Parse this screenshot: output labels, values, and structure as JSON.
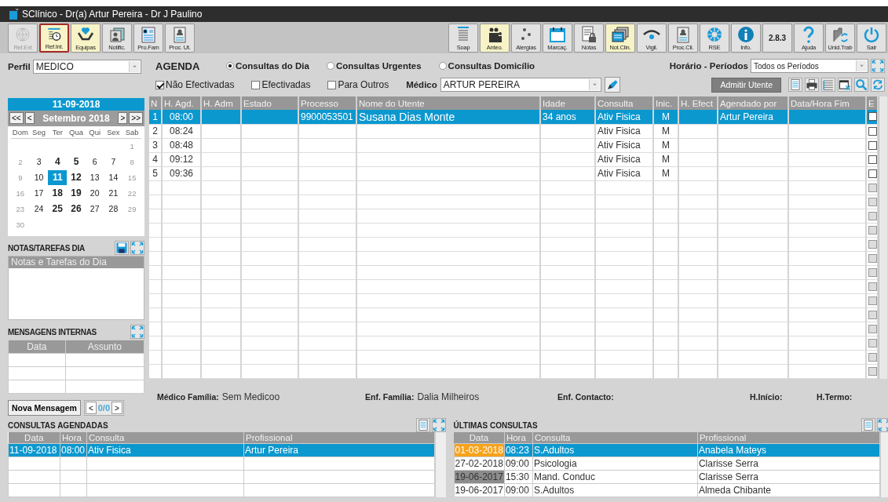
{
  "window": {
    "title": "SClínico - Dr(a) Artur Pereira - Dr J Paulino"
  },
  "toolbar": {
    "left": [
      {
        "label": "Ref.Ext",
        "kind": "network",
        "disabled": true,
        "highlighted": false,
        "selected": false
      },
      {
        "label": "Ref.Int.",
        "kind": "doc-clock",
        "disabled": false,
        "highlighted": true,
        "selected": true
      },
      {
        "label": "Equipas",
        "kind": "heart-hands",
        "disabled": false,
        "highlighted": true,
        "selected": false
      },
      {
        "label": "Notific.",
        "kind": "person-stack",
        "disabled": false,
        "highlighted": false,
        "selected": false
      },
      {
        "label": "Pro.Fam",
        "kind": "family-doc",
        "disabled": false,
        "highlighted": false,
        "selected": false
      },
      {
        "label": "Proc. Ut.",
        "kind": "person-card",
        "disabled": false,
        "highlighted": false,
        "selected": false
      }
    ],
    "right": [
      {
        "label": "Soap",
        "kind": "list",
        "disabled": false,
        "highlighted": false,
        "selected": false
      },
      {
        "label": "Anteo.",
        "kind": "people",
        "disabled": false,
        "highlighted": true,
        "selected": false
      },
      {
        "label": "Alergias",
        "kind": "dots",
        "disabled": false,
        "highlighted": false,
        "selected": false
      },
      {
        "label": "Marcaç.",
        "kind": "calendar",
        "disabled": false,
        "highlighted": false,
        "selected": false
      },
      {
        "label": "Notas",
        "kind": "doc-lock",
        "disabled": false,
        "highlighted": false,
        "selected": false
      },
      {
        "label": "Not.Clin.",
        "kind": "stack",
        "disabled": false,
        "highlighted": true,
        "selected": false
      },
      {
        "label": "Vigil.",
        "kind": "eye",
        "disabled": false,
        "highlighted": false,
        "selected": false
      },
      {
        "label": "Proc.Cli.",
        "kind": "person-card",
        "disabled": false,
        "highlighted": false,
        "selected": false
      },
      {
        "label": "RSE",
        "kind": "gear",
        "disabled": false,
        "highlighted": false,
        "selected": false
      },
      {
        "label": "Info.",
        "kind": "info",
        "disabled": false,
        "highlighted": false,
        "selected": false
      },
      {
        "label": "2.8.3",
        "kind": "version",
        "disabled": false,
        "highlighted": false,
        "selected": false
      },
      {
        "label": "Ajuda",
        "kind": "question",
        "disabled": false,
        "highlighted": false,
        "selected": false
      },
      {
        "label": "Unid.Trab",
        "kind": "building-refresh",
        "disabled": false,
        "highlighted": false,
        "selected": false
      },
      {
        "label": "Sair",
        "kind": "power",
        "disabled": false,
        "highlighted": false,
        "selected": false
      }
    ]
  },
  "sidebar": {
    "profile": {
      "label": "Perfil",
      "value": "MEDICO"
    },
    "calendar": {
      "date": "11-09-2018",
      "month": "Setembro 2018",
      "nav": [
        "<<",
        "<",
        ">",
        ">>"
      ],
      "weekdays": [
        "Dom",
        "Seg",
        "Ter",
        "Qua",
        "Qui",
        "Sex",
        "Sab"
      ],
      "weeks": [
        {
          "kind": "first",
          "days": [
            {
              "day": "1",
              "kind": "weekend",
              "selected": false
            }
          ]
        },
        {
          "kind": "full",
          "days": [
            {
              "day": "2",
              "kind": "weekend",
              "selected": false
            },
            {
              "day": "3",
              "kind": "plain",
              "selected": false
            },
            {
              "day": "4",
              "kind": "marked",
              "selected": false
            },
            {
              "day": "5",
              "kind": "marked",
              "selected": false
            },
            {
              "day": "6",
              "kind": "plain",
              "selected": false
            },
            {
              "day": "7",
              "kind": "plain",
              "selected": false
            },
            {
              "day": "8",
              "kind": "weekend",
              "selected": false
            }
          ]
        },
        {
          "kind": "full",
          "days": [
            {
              "day": "9",
              "kind": "weekend",
              "selected": false
            },
            {
              "day": "10",
              "kind": "plain",
              "selected": false
            },
            {
              "day": "11",
              "kind": "marked",
              "selected": true
            },
            {
              "day": "12",
              "kind": "marked",
              "selected": false
            },
            {
              "day": "13",
              "kind": "plain",
              "selected": false
            },
            {
              "day": "14",
              "kind": "plain",
              "selected": false
            },
            {
              "day": "15",
              "kind": "weekend",
              "selected": false
            }
          ]
        },
        {
          "kind": "full",
          "days": [
            {
              "day": "16",
              "kind": "weekend",
              "selected": false
            },
            {
              "day": "17",
              "kind": "plain",
              "selected": false
            },
            {
              "day": "18",
              "kind": "marked",
              "selected": false
            },
            {
              "day": "19",
              "kind": "marked",
              "selected": false
            },
            {
              "day": "20",
              "kind": "plain",
              "selected": false
            },
            {
              "day": "21",
              "kind": "plain",
              "selected": false
            },
            {
              "day": "22",
              "kind": "weekend",
              "selected": false
            }
          ]
        },
        {
          "kind": "full",
          "days": [
            {
              "day": "23",
              "kind": "weekend",
              "selected": false
            },
            {
              "day": "24",
              "kind": "plain",
              "selected": false
            },
            {
              "day": "25",
              "kind": "marked",
              "selected": false
            },
            {
              "day": "26",
              "kind": "marked",
              "selected": false
            },
            {
              "day": "27",
              "kind": "plain",
              "selected": false
            },
            {
              "day": "28",
              "kind": "plain",
              "selected": false
            },
            {
              "day": "29",
              "kind": "weekend",
              "selected": false
            }
          ]
        },
        {
          "kind": "last",
          "days": [
            {
              "day": "30",
              "kind": "weekend",
              "selected": false
            }
          ]
        }
      ]
    },
    "notes": {
      "title": "NOTAS/TAREFAS DIA",
      "header": "Notas e Tarefas do Dia"
    },
    "messages": {
      "title": "MENSAGENS INTERNAS",
      "columns": [
        "Data",
        "Assunto"
      ],
      "new_button": "Nova Mensagem",
      "prev": "<",
      "count": "0/0",
      "next": ">"
    }
  },
  "agenda": {
    "title": "AGENDA",
    "radios": [
      {
        "label": "Consultas do Dia",
        "selected": true
      },
      {
        "label": "Consultas Urgentes",
        "selected": false
      },
      {
        "label": "Consultas Domicílio",
        "selected": false
      }
    ],
    "filters": [
      {
        "label": "Não Efectivadas",
        "checked": true
      },
      {
        "label": "Efectivadas",
        "checked": false
      },
      {
        "label": "Para Outros",
        "checked": false
      }
    ],
    "doctor": {
      "label": "Médico",
      "value": "ARTUR PEREIRA"
    },
    "periods": {
      "label": "Horário - Períodos",
      "value": "Todos os Períodos"
    },
    "admit_button": "Admitir Utente",
    "table": {
      "columns": [
        "N",
        "H. Agd.",
        "H. Adm",
        "Estado",
        "Processo",
        "Nome do Utente",
        "Idade",
        "Consulta",
        "Inic.",
        "H. Efect",
        "Agendado por",
        "Data/Hora Fim",
        "E"
      ],
      "rows": [
        {
          "n": "1",
          "h_agd": "08:00",
          "processo": "9900053501",
          "nome": "Susana Dias Monte",
          "idade": "34 anos",
          "consulta": "Ativ Fisica",
          "inic": "M",
          "agendado_por": "Artur Pereira",
          "selected": true,
          "checked": false,
          "disabled": false
        },
        {
          "n": "2",
          "h_agd": "08:24",
          "consulta": "Ativ Fisica",
          "inic": "M",
          "selected": false,
          "checked": false,
          "disabled": false
        },
        {
          "n": "3",
          "h_agd": "08:48",
          "consulta": "Ativ Fisica",
          "inic": "M",
          "selected": false,
          "checked": false,
          "disabled": false
        },
        {
          "n": "4",
          "h_agd": "09:12",
          "consulta": "Ativ Fisica",
          "inic": "M",
          "selected": false,
          "checked": false,
          "disabled": false
        },
        {
          "n": "5",
          "h_agd": "09:36",
          "consulta": "Ativ Fisica",
          "inic": "M",
          "selected": false,
          "checked": false,
          "disabled": false
        },
        {
          "selected": false,
          "checked": false,
          "disabled": true
        },
        {
          "selected": false,
          "checked": false,
          "disabled": true
        },
        {
          "selected": false,
          "checked": false,
          "disabled": true
        },
        {
          "selected": false,
          "checked": false,
          "disabled": true
        },
        {
          "selected": false,
          "checked": false,
          "disabled": true
        },
        {
          "selected": false,
          "checked": false,
          "disabled": true
        },
        {
          "selected": false,
          "checked": false,
          "disabled": true
        },
        {
          "selected": false,
          "checked": false,
          "disabled": true
        },
        {
          "selected": false,
          "checked": false,
          "disabled": true
        },
        {
          "selected": false,
          "checked": false,
          "disabled": true
        },
        {
          "selected": false,
          "checked": false,
          "disabled": true
        },
        {
          "selected": false,
          "checked": false,
          "disabled": true
        },
        {
          "selected": false,
          "checked": false,
          "disabled": true
        },
        {
          "selected": false,
          "checked": false,
          "disabled": true
        }
      ]
    },
    "info": [
      {
        "label": "Médico Família:",
        "value": "Sem Medicoo"
      },
      {
        "label": "Enf. Família:",
        "value": "Dalia Milheiros"
      },
      {
        "label": "Enf. Contacto:"
      },
      {
        "label": "H.Início:"
      },
      {
        "label": "H.Termo:"
      }
    ]
  },
  "scheduled": {
    "title": "CONSULTAS AGENDADAS",
    "columns": [
      "Data",
      "Hora",
      "Consulta",
      "Profissional"
    ],
    "rows": [
      {
        "data": "11-09-2018",
        "hora": "08:00",
        "consulta": "Ativ Fisica",
        "profissional": "Artur Pereira",
        "selected": true
      }
    ]
  },
  "recent": {
    "title": "ÚLTIMAS CONSULTAS",
    "columns": [
      "Data",
      "Hora",
      "Consulta",
      "Profissional"
    ],
    "rows": [
      {
        "data": "01-03-2018",
        "hora": "08:23",
        "consulta": "S.Adultos",
        "profissional": "Anabela Mateys",
        "selected": true,
        "color": "#f7a21b"
      },
      {
        "data": "27-02-2018",
        "hora": "09:00",
        "consulta": "Psicologia",
        "profissional": "Clarisse Serra",
        "selected": false
      },
      {
        "data": "19-06-2017",
        "hora": "15:30",
        "consulta": "Mand. Conduc",
        "profissional": "Clarisse Serra",
        "selected": false,
        "color": "#8c8c8c"
      },
      {
        "data": "19-06-2017",
        "hora": "09:00",
        "consulta": "S.Adultos",
        "profissional": "Almeda Chibante",
        "selected": false
      }
    ]
  }
}
